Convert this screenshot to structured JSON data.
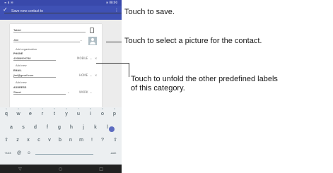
{
  "status_bar": {
    "left": "≡ ⬇ ✉",
    "right": "≋ 08:00"
  },
  "app_bar": {
    "title": "Save new contact to",
    "more": "⋮"
  },
  "form": {
    "account": "Tablet",
    "name_value": "Jimi",
    "add_organization": "Add organization",
    "phone_label": "PHONE",
    "phone_value": "40586999788",
    "phone_type": "MOBILE",
    "add_new_1": "Add new",
    "email_label": "EMAIL",
    "email_value": "jimi@gmail.com",
    "email_type": "HOME",
    "add_new_2": "Add new",
    "address_label": "ADDRESS",
    "address_value": "Street",
    "address_type": "WORK"
  },
  "keyboard": {
    "row1": [
      "q",
      "w",
      "e",
      "r",
      "t",
      "y",
      "u",
      "i",
      "o",
      "p"
    ],
    "row1_nums": [
      "1",
      "2",
      "3",
      "4",
      "5",
      "6",
      "7",
      "8",
      "9",
      "0"
    ],
    "row2": [
      "a",
      "s",
      "d",
      "f",
      "g",
      "h",
      "j",
      "k",
      "l"
    ],
    "row3": [
      "z",
      "x",
      "c",
      "v",
      "b",
      "n",
      "m",
      "!",
      "?"
    ],
    "row4_left": "?123",
    "row4_right": ".com"
  },
  "annotations": {
    "save": "Touch to save.",
    "picture": "Touch to select a picture for the contact.",
    "unfold": "Touch to unfold the other predefined labels of this category."
  }
}
